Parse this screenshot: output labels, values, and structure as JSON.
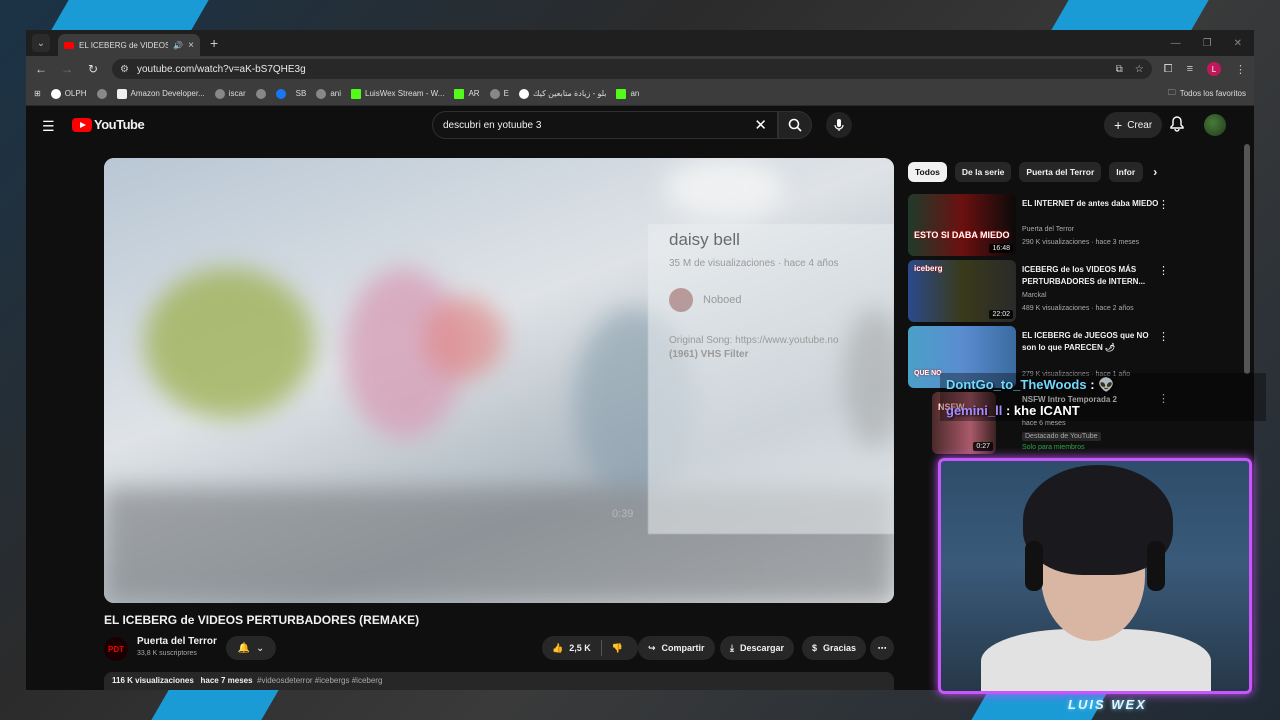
{
  "browser": {
    "tab_title": "EL ICEBERG de VIDEOS PER",
    "url": "youtube.com/watch?v=aK-bS7QHE3g",
    "bookmarks": [
      "OLPH",
      "Amazon Developer...",
      "iscar",
      "SB",
      "ani",
      "LuisWex Stream - W...",
      "AR",
      "E",
      "بلو - زيادة متابعين كيك",
      "an"
    ],
    "all_bookmarks": "Todos los favoritos",
    "profile_letter": "L"
  },
  "yt": {
    "logo": "YouTube",
    "search_query": "descubri en yotuube 3",
    "create_label": "Crear",
    "player_overlay": {
      "title": "daisy bell",
      "meta": "35 M de visualizaciones · hace 4 años",
      "channel": "Noboed",
      "desc_line1": "Original Song: https://www.youtube.no",
      "desc_line2": "(1961) VHS Filter",
      "duration": "0:39"
    },
    "video_title": "EL ICEBERG de VIDEOS PERTURBADORES (REMAKE)",
    "channel_name": "Puerta del Terror",
    "channel_avatar_text": "PDT",
    "channel_subs": "33,8 K suscriptores",
    "likes": "2,5 K",
    "share_label": "Compartir",
    "download_label": "Descargar",
    "thanks_label": "Gracias",
    "views": "116 K visualizaciones",
    "date": "hace 7 meses",
    "tags": "#videosdeterror #icebergs #iceberg",
    "chips": [
      "Todos",
      "De la serie",
      "Puerta del Terror",
      "Infor"
    ],
    "recommendations": [
      {
        "title": "EL INTERNET de antes daba MIEDO",
        "channel": "Puerta del Terror",
        "meta": "290 K visualizaciones · hace 3 meses",
        "duration": "16:48",
        "thumb_text": "ESTO SI DABA MIEDO"
      },
      {
        "title": "ICEBERG de los VIDEOS MÁS PERTURBADORES de INTERN...",
        "channel": "Marckal",
        "meta": "489 K visualizaciones · hace 2 años",
        "duration": "22:02",
        "thumb_text": "iceberg"
      },
      {
        "title": "EL ICEBERG de JUEGOS que NO son lo que PARECEN 🌶",
        "channel": "",
        "meta": "279 K visualizaciones · hace 1 año",
        "duration": "",
        "thumb_text": "QUE NO"
      },
      {
        "title": "NSFW Intro Temporada 2",
        "channel": "hace 6 meses",
        "meta": "Destacado de YouTube",
        "members": "Solo para miembros",
        "duration": "0:27",
        "thumb_text": "NSFW"
      }
    ]
  },
  "chat": [
    {
      "user": "DontGo_to_TheWoods",
      "text": ":"
    },
    {
      "user": "gemini_ll",
      "text": ": khe ICANT"
    }
  ],
  "streamer_name": "LUIS WEX"
}
